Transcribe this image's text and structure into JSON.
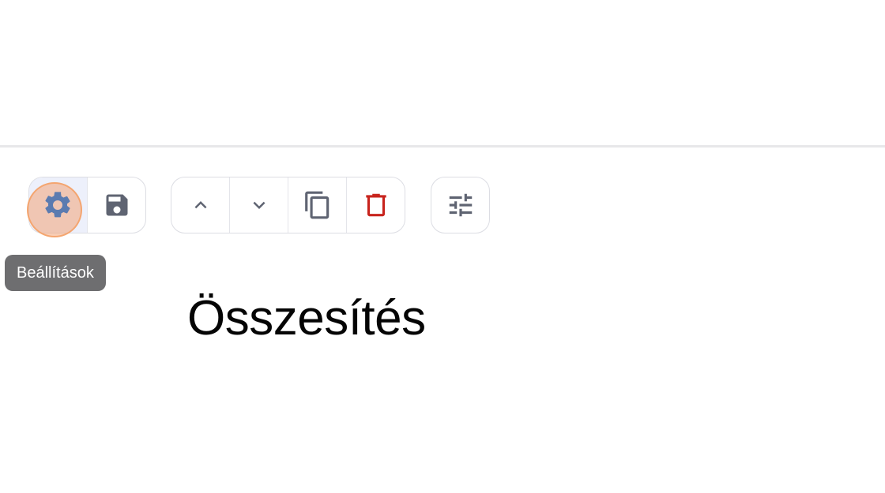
{
  "toolbar": {
    "settings_icon": "gear-icon",
    "save_icon": "floppy-disk-icon",
    "move_up_icon": "chevron-up-icon",
    "move_down_icon": "chevron-down-icon",
    "duplicate_icon": "copy-icon",
    "delete_icon": "trash-icon",
    "adjust_icon": "sliders-icon"
  },
  "tooltip": {
    "text": "Beállítások"
  },
  "content": {
    "title": "Összesítés"
  },
  "colors": {
    "icon": "#5f6472",
    "gear": "#5b7bb0",
    "delete": "#c8241d",
    "focus": "#f3a478",
    "tooltip_bg": "#6e6e70"
  }
}
